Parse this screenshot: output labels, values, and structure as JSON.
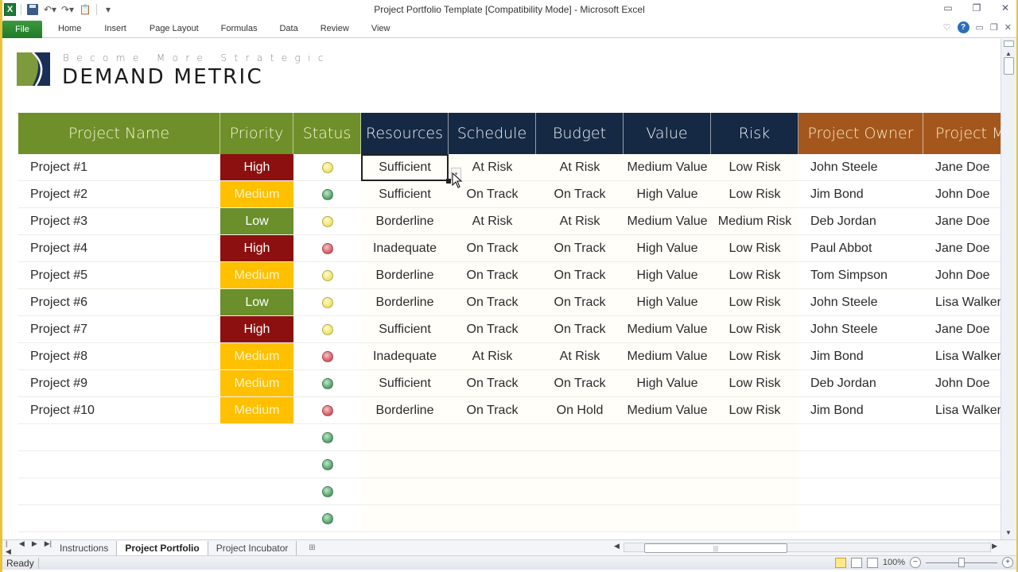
{
  "window": {
    "title": "Project Portfolio Template  [Compatibility Mode]  -  Microsoft Excel",
    "controls": [
      "minimize",
      "restore",
      "close"
    ]
  },
  "qat": {
    "icons": [
      "excel-logo-icon",
      "save-icon",
      "undo-icon",
      "redo-icon",
      "paste-icon",
      "customize-icon"
    ]
  },
  "ribbon": {
    "file_label": "File",
    "tabs": [
      "Home",
      "Insert",
      "Page Layout",
      "Formulas",
      "Data",
      "Review",
      "View"
    ]
  },
  "logo": {
    "tagline": "Become More Strategic",
    "brand_first": "Demand",
    "brand_second": "Metric"
  },
  "table": {
    "headers": [
      "Project Name",
      "Priority",
      "Status",
      "Resources",
      "Schedule",
      "Budget",
      "Value",
      "Risk",
      "Project Owner",
      "Project M"
    ],
    "header_colors": {
      "green": "#6f8f2a",
      "navy": "#152944",
      "orange": "#a4571c"
    },
    "priority_colors": {
      "High": "#8c1010",
      "Medium": "#ffc000",
      "Low": "#6a8f2b"
    },
    "status_colors": {
      "yellow": "#efe160",
      "green": "#4e9e68",
      "red": "#d2575e"
    },
    "rows": [
      {
        "name": "Project #1",
        "priority": "High",
        "status": "yellow",
        "resources": "Sufficient",
        "schedule": "At Risk",
        "budget": "At Risk",
        "value": "Medium Value",
        "risk": "Low Risk",
        "owner": "John Steele",
        "manager": "Jane Doe"
      },
      {
        "name": "Project #2",
        "priority": "Medium",
        "status": "green",
        "resources": "Sufficient",
        "schedule": "On Track",
        "budget": "On Track",
        "value": "High Value",
        "risk": "Low Risk",
        "owner": "Jim Bond",
        "manager": "John Doe"
      },
      {
        "name": "Project #3",
        "priority": "Low",
        "status": "yellow",
        "resources": "Borderline",
        "schedule": "At Risk",
        "budget": "At Risk",
        "value": "Medium Value",
        "risk": "Medium Risk",
        "owner": "Deb Jordan",
        "manager": "Jane Doe"
      },
      {
        "name": "Project #4",
        "priority": "High",
        "status": "red",
        "resources": "Inadequate",
        "schedule": "On Track",
        "budget": "On Track",
        "value": "High Value",
        "risk": "Low Risk",
        "owner": "Paul Abbot",
        "manager": "Jane Doe"
      },
      {
        "name": "Project #5",
        "priority": "Medium",
        "status": "yellow",
        "resources": "Borderline",
        "schedule": "On Track",
        "budget": "On Track",
        "value": "High Value",
        "risk": "Low Risk",
        "owner": "Tom Simpson",
        "manager": "John Doe"
      },
      {
        "name": "Project #6",
        "priority": "Low",
        "status": "yellow",
        "resources": "Borderline",
        "schedule": "On Track",
        "budget": "On Track",
        "value": "High Value",
        "risk": "Low Risk",
        "owner": "John Steele",
        "manager": "Lisa Walker"
      },
      {
        "name": "Project #7",
        "priority": "High",
        "status": "yellow",
        "resources": "Sufficient",
        "schedule": "On Track",
        "budget": "On Track",
        "value": "Medium Value",
        "risk": "Low Risk",
        "owner": "John Steele",
        "manager": "Jane Doe"
      },
      {
        "name": "Project #8",
        "priority": "Medium",
        "status": "red",
        "resources": "Inadequate",
        "schedule": "At Risk",
        "budget": "At Risk",
        "value": "Medium Value",
        "risk": "Low Risk",
        "owner": "Jim Bond",
        "manager": "Lisa Walker"
      },
      {
        "name": "Project #9",
        "priority": "Medium",
        "status": "green",
        "resources": "Sufficient",
        "schedule": "On Track",
        "budget": "On Track",
        "value": "High Value",
        "risk": "Low Risk",
        "owner": "Deb Jordan",
        "manager": "John Doe"
      },
      {
        "name": "Project #10",
        "priority": "Medium",
        "status": "red",
        "resources": "Borderline",
        "schedule": "On Track",
        "budget": "On Hold",
        "value": "Medium Value",
        "risk": "Low Risk",
        "owner": "Jim Bond",
        "manager": "Lisa Walker"
      },
      {
        "name": "",
        "priority": "",
        "status": "green",
        "resources": "",
        "schedule": "",
        "budget": "",
        "value": "",
        "risk": "",
        "owner": "",
        "manager": ""
      },
      {
        "name": "",
        "priority": "",
        "status": "green",
        "resources": "",
        "schedule": "",
        "budget": "",
        "value": "",
        "risk": "",
        "owner": "",
        "manager": ""
      },
      {
        "name": "",
        "priority": "",
        "status": "green",
        "resources": "",
        "schedule": "",
        "budget": "",
        "value": "",
        "risk": "",
        "owner": "",
        "manager": ""
      },
      {
        "name": "",
        "priority": "",
        "status": "green",
        "resources": "",
        "schedule": "",
        "budget": "",
        "value": "",
        "risk": "",
        "owner": "",
        "manager": ""
      }
    ],
    "selected_cell": {
      "row": 1,
      "column": "Resources"
    }
  },
  "sheet_tabs": {
    "tabs": [
      "Instructions",
      "Project Portfolio",
      "Project Incubator"
    ],
    "active": "Project Portfolio"
  },
  "status": {
    "ready": "Ready",
    "zoom": "100%"
  }
}
